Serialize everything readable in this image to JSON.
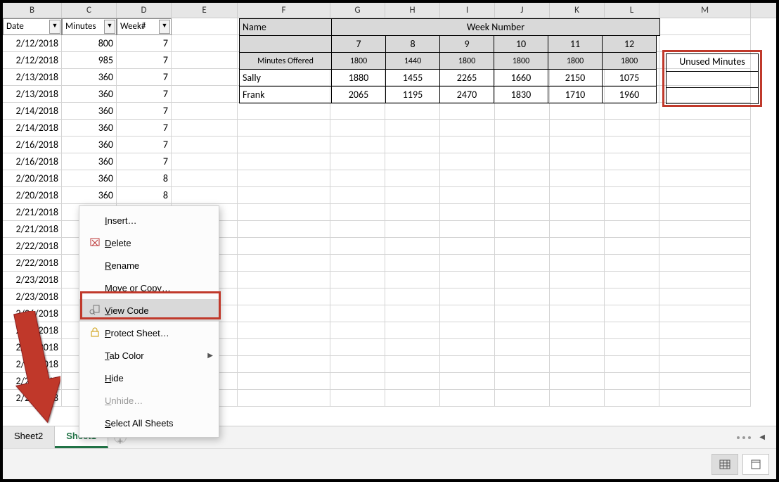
{
  "columns": [
    "B",
    "C",
    "D",
    "E",
    "F",
    "G",
    "H",
    "I",
    "J",
    "K",
    "L",
    "M"
  ],
  "filter_headers": {
    "date": "Date",
    "minutes": "Minutes",
    "week": "Week#"
  },
  "rows": [
    {
      "date": "2/12/2018",
      "min": "800",
      "wk": "7"
    },
    {
      "date": "2/12/2018",
      "min": "985",
      "wk": "7"
    },
    {
      "date": "2/13/2018",
      "min": "360",
      "wk": "7"
    },
    {
      "date": "2/13/2018",
      "min": "360",
      "wk": "7"
    },
    {
      "date": "2/14/2018",
      "min": "360",
      "wk": "7"
    },
    {
      "date": "2/14/2018",
      "min": "360",
      "wk": "7"
    },
    {
      "date": "2/16/2018",
      "min": "360",
      "wk": "7"
    },
    {
      "date": "2/16/2018",
      "min": "360",
      "wk": "7"
    },
    {
      "date": "2/20/2018",
      "min": "360",
      "wk": "8"
    },
    {
      "date": "2/20/2018",
      "min": "360",
      "wk": "8"
    },
    {
      "date": "2/21/2018",
      "min": "",
      "wk": ""
    },
    {
      "date": "2/21/2018",
      "min": "",
      "wk": ""
    },
    {
      "date": "2/22/2018",
      "min": "",
      "wk": ""
    },
    {
      "date": "2/22/2018",
      "min": "",
      "wk": ""
    },
    {
      "date": "2/23/2018",
      "min": "",
      "wk": ""
    },
    {
      "date": "2/23/2018",
      "min": "",
      "wk": ""
    },
    {
      "date": "2/26/2018",
      "min": "",
      "wk": ""
    },
    {
      "date": "2/26/2018",
      "min": "",
      "wk": ""
    },
    {
      "date": "2/27/2018",
      "min": "",
      "wk": ""
    },
    {
      "date": "2/27/2018",
      "min": "",
      "wk": ""
    },
    {
      "date": "2/28/2018",
      "min": "",
      "wk": ""
    },
    {
      "date": "2/28/2018",
      "min": "",
      "wk": ""
    }
  ],
  "summary": {
    "week_number_header": "Week Number",
    "name_header": "Name",
    "weeks": [
      "7",
      "8",
      "9",
      "10",
      "11",
      "12"
    ],
    "minutes_offered_label": "Minutes Offered",
    "minutes_offered": [
      "1800",
      "1440",
      "1800",
      "1800",
      "1800",
      "1800"
    ],
    "sally_name": "Sally",
    "sally": [
      "1880",
      "1455",
      "2265",
      "1660",
      "2150",
      "1075"
    ],
    "frank_name": "Frank",
    "frank": [
      "2065",
      "1195",
      "2470",
      "1830",
      "1710",
      "1960"
    ]
  },
  "unused_minutes_label": "Unused Minutes",
  "context_menu": {
    "insert": "Insert…",
    "delete": "Delete",
    "rename": "Rename",
    "move_copy": "Move or Copy…",
    "view_code": "View Code",
    "protect_sheet": "Protect Sheet…",
    "tab_color": "Tab Color",
    "hide": "Hide",
    "unhide": "Unhide…",
    "select_all": "Select All Sheets"
  },
  "tabs": {
    "sheet2": "Sheet2",
    "sheet1": "Sheet1"
  }
}
